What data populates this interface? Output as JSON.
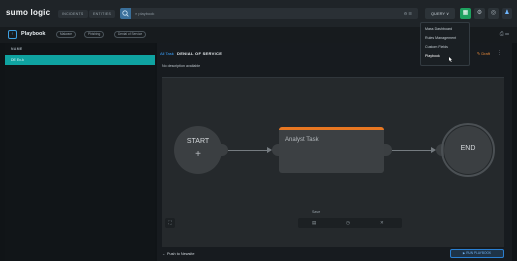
{
  "app": {
    "logo": "sumo logic"
  },
  "topnav": {
    "incidents": "INCIDENTS",
    "entities": "ENTITIES"
  },
  "search": {
    "placeholder": "⌕ playbook",
    "tools": "⚙ ☰"
  },
  "query_button": "QUERY ∨",
  "top_icons": {
    "green": "▦",
    "settings": "⚙",
    "help": "◎",
    "user": "♟"
  },
  "dropdown": {
    "items": [
      "Mass Dashboard",
      "Rules Management",
      "Custom Fields",
      "Playbook"
    ],
    "active": "Playbook"
  },
  "subheader": {
    "back": "‹",
    "title": "Playbook",
    "tags": [
      "Malware",
      "Phishing",
      "Denial of Service"
    ],
    "right_icons": "⎙ ▭"
  },
  "leftpane": {
    "header": "NAME",
    "rows": [
      "DE Ex-k"
    ]
  },
  "main": {
    "tab": "All Task",
    "task_title": "DENIAL OF SERVICE",
    "description": "No description available",
    "edit": "✎ Draft",
    "more": "⋮"
  },
  "flow": {
    "start_label": "START",
    "start_plus": "+",
    "task_name": "Analyst Task",
    "end_label": "END"
  },
  "canvas_toolbar": {
    "label": "Save",
    "buttons": [
      "▤",
      "◷",
      "✕"
    ],
    "zoom": "⛶"
  },
  "footer": {
    "icon": "⌄",
    "text": "Push to Newsite",
    "button": "▶ RUN PLAYBOOK"
  },
  "colors": {
    "accent_teal": "#0fa3a1",
    "accent_orange": "#e87722",
    "accent_green": "#1ea15f",
    "link_blue": "#3aa3ff"
  }
}
